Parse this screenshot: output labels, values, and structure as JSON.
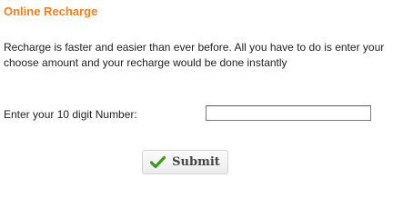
{
  "page": {
    "title": "Online Recharge",
    "intro": "Recharge is faster and easier than ever before. All you have to do is enter your choose amount and your recharge would be done instantly"
  },
  "form": {
    "number_label": "Enter your 10 digit Number:",
    "number_value": "",
    "submit_label": "Submit",
    "submit_icon": "check-icon"
  },
  "colors": {
    "title": "#f07f1e",
    "check": "#3c9a18"
  }
}
